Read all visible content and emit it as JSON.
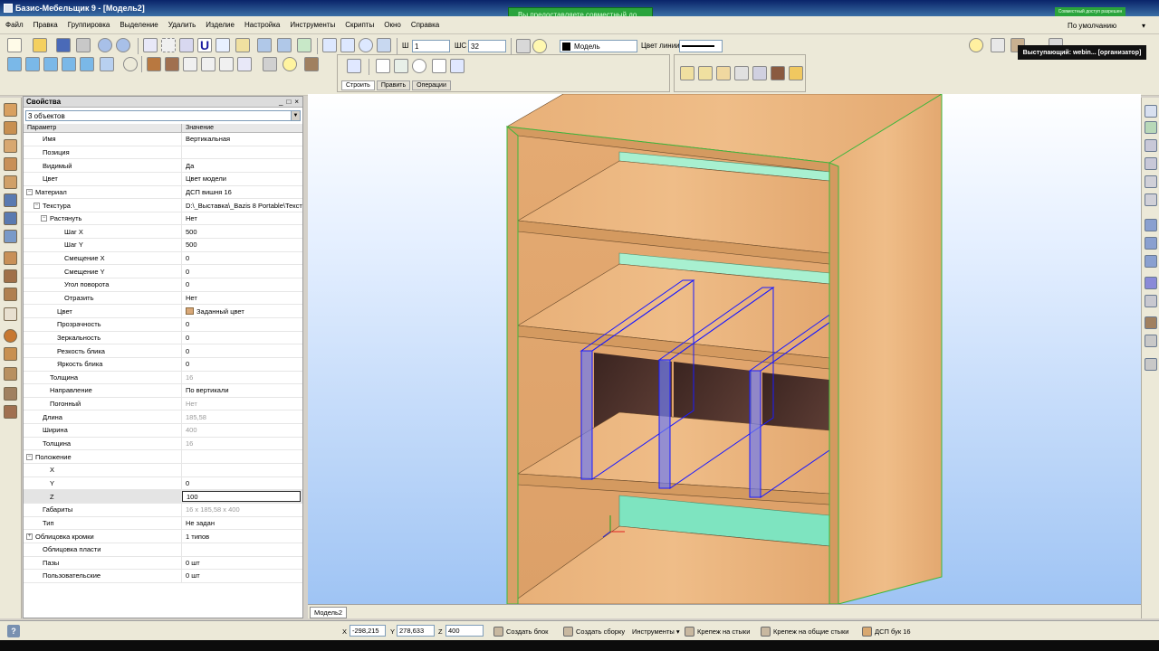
{
  "window": {
    "title": "Базис-Мебельщик 9 - [Модель2]",
    "collab_banner": "Вы предоставляете совместный до...",
    "collab_small": "Совместный доступ разрешен",
    "presenter": "Выступающий: webin... [организатор]"
  },
  "menu": [
    "Файл",
    "Правка",
    "Группировка",
    "Выделение",
    "Удалить",
    "Изделие",
    "Настройка",
    "Инструменты",
    "Скрипты",
    "Окно",
    "Справка"
  ],
  "toolbar": {
    "w_label": "Ш",
    "w_value": "1",
    "wc_label": "ШС",
    "wc_value": "32",
    "layer_value": "Модель",
    "line_color_label": "Цвет линии",
    "layout_value": "По умолчанию"
  },
  "build_tabs": [
    "Строить",
    "Править",
    "Операции"
  ],
  "properties": {
    "title": "Свойства",
    "controls": [
      "_",
      "□",
      "×"
    ],
    "object_count": "3 объектов",
    "col_param": "Параметр",
    "col_value": "Значение",
    "rows": [
      {
        "name": "Имя",
        "value": "Вертикальная",
        "indent": 1,
        "exp": "",
        "grey": false
      },
      {
        "name": "Позиция",
        "value": "",
        "indent": 1,
        "exp": "",
        "grey": false
      },
      {
        "name": "Видимый",
        "value": "Да",
        "indent": 1,
        "exp": "",
        "grey": false
      },
      {
        "name": "Цвет",
        "value": "Цвет модели",
        "indent": 1,
        "exp": "",
        "grey": false
      },
      {
        "name": "Материал",
        "value": "ДСП вишня 16",
        "indent": 0,
        "exp": "−",
        "grey": false
      },
      {
        "name": "Текстура",
        "value": "D:\\_Выставка\\_Bazis 8 Portable\\Текст",
        "indent": 1,
        "exp": "−",
        "grey": false
      },
      {
        "name": "Растянуть",
        "value": "Нет",
        "indent": 2,
        "exp": "−",
        "grey": false
      },
      {
        "name": "Шаг X",
        "value": "500",
        "indent": 4,
        "exp": "",
        "grey": false
      },
      {
        "name": "Шаг Y",
        "value": "500",
        "indent": 4,
        "exp": "",
        "grey": false
      },
      {
        "name": "Смещение X",
        "value": "0",
        "indent": 4,
        "exp": "",
        "grey": false
      },
      {
        "name": "Смещение Y",
        "value": "0",
        "indent": 4,
        "exp": "",
        "grey": false
      },
      {
        "name": "Угол поворота",
        "value": "0",
        "indent": 4,
        "exp": "",
        "grey": false
      },
      {
        "name": "Отразить",
        "value": "Нет",
        "indent": 4,
        "exp": "",
        "grey": false
      },
      {
        "name": "Цвет",
        "value": "Заданный цвет",
        "indent": 3,
        "exp": "",
        "grey": false,
        "swatch": true
      },
      {
        "name": "Прозрачность",
        "value": "0",
        "indent": 3,
        "exp": "",
        "grey": false
      },
      {
        "name": "Зеркальность",
        "value": "0",
        "indent": 3,
        "exp": "",
        "grey": false
      },
      {
        "name": "Резкость блика",
        "value": "0",
        "indent": 3,
        "exp": "",
        "grey": false
      },
      {
        "name": "Яркость блика",
        "value": "0",
        "indent": 3,
        "exp": "",
        "grey": false
      },
      {
        "name": "Толщина",
        "value": "16",
        "indent": 2,
        "exp": "",
        "grey": true
      },
      {
        "name": "Направление",
        "value": "По вертикали",
        "indent": 2,
        "exp": "",
        "grey": false
      },
      {
        "name": "Погонный",
        "value": "Нет",
        "indent": 2,
        "exp": "",
        "grey": true
      },
      {
        "name": "Длина",
        "value": "185,58",
        "indent": 1,
        "exp": "",
        "grey": true
      },
      {
        "name": "Ширина",
        "value": "400",
        "indent": 1,
        "exp": "",
        "grey": true
      },
      {
        "name": "Толщина",
        "value": "16",
        "indent": 1,
        "exp": "",
        "grey": true
      },
      {
        "name": "Положение",
        "value": "",
        "indent": 0,
        "exp": "−",
        "grey": false
      },
      {
        "name": "X",
        "value": "",
        "indent": 2,
        "exp": "",
        "grey": false
      },
      {
        "name": "Y",
        "value": "0",
        "indent": 2,
        "exp": "",
        "grey": false
      },
      {
        "name": "Z",
        "value": "100",
        "indent": 2,
        "exp": "",
        "grey": false,
        "editing": true
      },
      {
        "name": "Габариты",
        "value": "16 x 185,58 x 400",
        "indent": 1,
        "exp": "",
        "grey": true
      },
      {
        "name": "Тип",
        "value": "Не задан",
        "indent": 1,
        "exp": "",
        "grey": false
      },
      {
        "name": "Облицовка кромки",
        "value": "1 типов",
        "indent": 0,
        "exp": "+",
        "grey": false
      },
      {
        "name": "Облицовка пласти",
        "value": "",
        "indent": 1,
        "exp": "",
        "grey": false
      },
      {
        "name": "Пазы",
        "value": "0 шт",
        "indent": 1,
        "exp": "",
        "grey": false
      },
      {
        "name": "Пользовательские",
        "value": "0 шт",
        "indent": 1,
        "exp": "",
        "grey": false
      }
    ]
  },
  "viewport": {
    "tab": "Модель2"
  },
  "status": {
    "help": "?",
    "x_label": "X",
    "x_value": "-298,215",
    "y_label": "Y",
    "y_value": "278,633",
    "z_label": "Z",
    "z_value": "400",
    "buttons": [
      "Создать блок",
      "Создать сборку",
      "Инструменты ▾",
      "Крепеж на стыки",
      "Крепеж на общие стыки"
    ],
    "material": "ДСП бук 16"
  },
  "colors": {
    "wood": "#e8b078",
    "wood_dark": "#c8925a",
    "selection": "#1a1aff",
    "back_panel": "#5a3a32",
    "mint": "#a8f0d0",
    "edge_green": "#3cb83c"
  }
}
